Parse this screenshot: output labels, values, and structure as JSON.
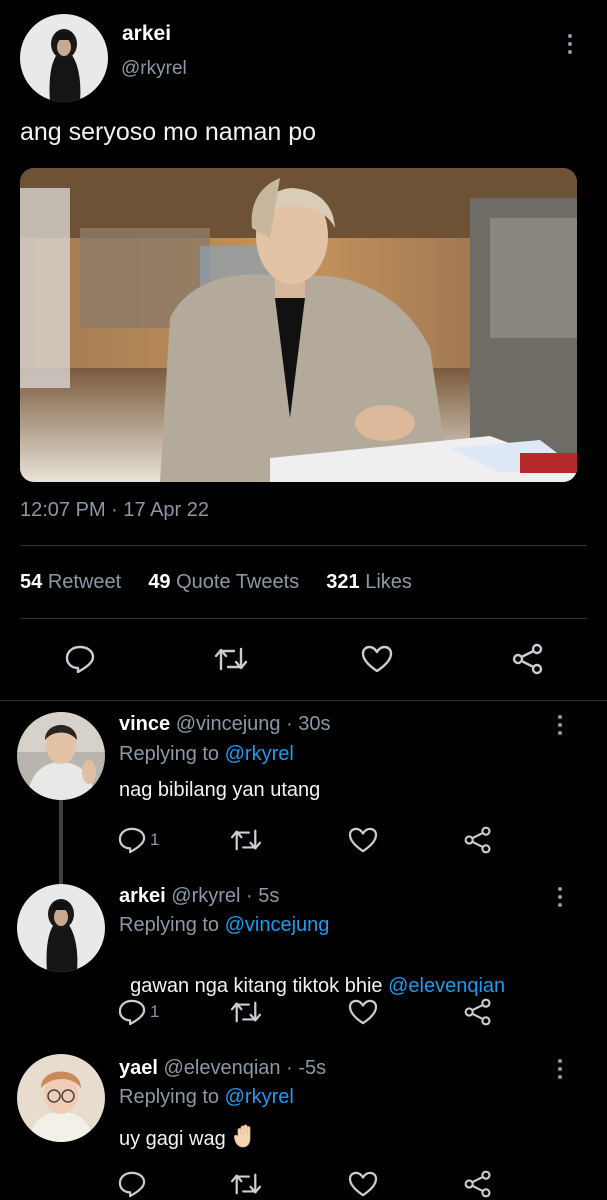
{
  "tweet": {
    "author_name": "arkei",
    "author_handle": "@rkyrel",
    "text": "ang seryoso mo naman po",
    "timestamp": "12:07 PM · 17 Apr 22",
    "stats": {
      "retweets_count": "54",
      "retweets_label": "Retweet",
      "quotes_count": "49",
      "quotes_label": "Quote Tweets",
      "likes_count": "321",
      "likes_label": "Likes"
    }
  },
  "replies": [
    {
      "name": "vince",
      "meta": "@vincejung · 30s",
      "replying_prefix": "Replying to ",
      "replying_to": "@rkyrel",
      "text": "nag bibilang yan utang",
      "mention": "",
      "reply_count": "1"
    },
    {
      "name": "arkei",
      "meta": "@rkyrel · 5s",
      "replying_prefix": "Replying to ",
      "replying_to": "@vincejung",
      "text": "gawan nga kitang tiktok bhie ",
      "mention": "@elevenqian",
      "reply_count": "1"
    },
    {
      "name": "yael",
      "meta": "@elevenqian · -5s",
      "replying_prefix": "Replying to ",
      "replying_to": "@rkyrel",
      "text": "uy gagi wag",
      "mention": "",
      "reply_count": ""
    }
  ],
  "icons": {
    "more": "kebab-icon",
    "reply": "reply-icon",
    "retweet": "retweet-icon",
    "like": "heart-icon",
    "share": "share-icon",
    "emoji": "raised-hand-emoji"
  },
  "colors": {
    "background": "#000000",
    "link": "#1d9bf0",
    "muted": "#8b98a5",
    "divider": "#2f3336"
  }
}
